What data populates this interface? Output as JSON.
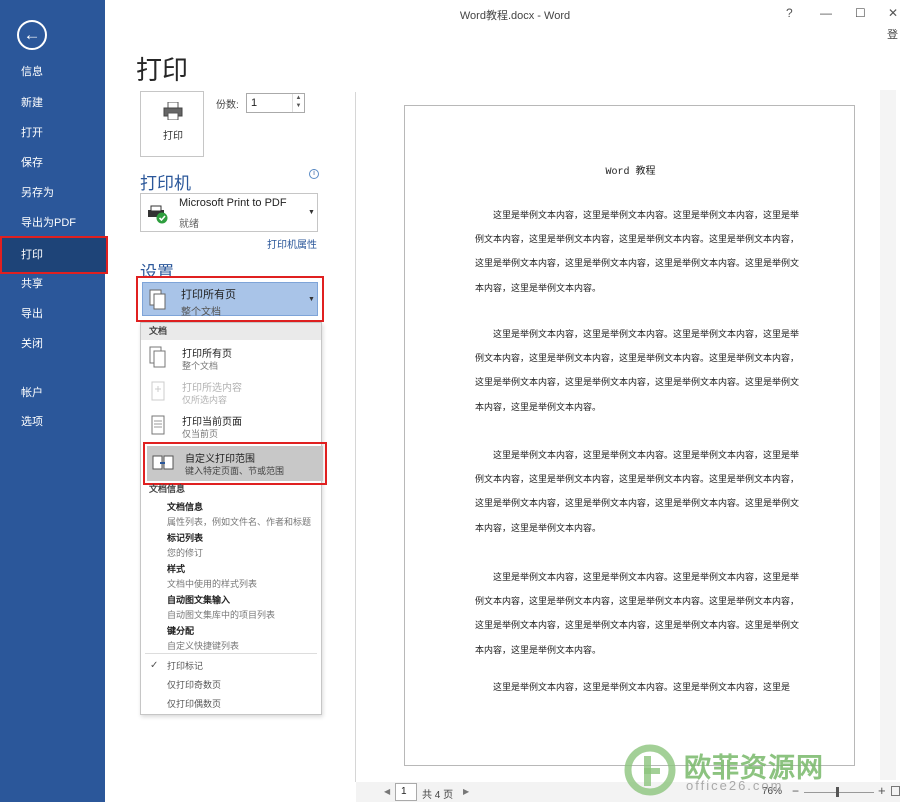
{
  "window": {
    "title": "Word教程.docx - Word",
    "signin": "登",
    "controls": {
      "help": "?",
      "minimize": "—",
      "maximize": "☐",
      "close": "✕"
    }
  },
  "sidebar": {
    "back_icon": "arrow-left-icon",
    "items": [
      {
        "label": "信息"
      },
      {
        "label": "新建"
      },
      {
        "label": "打开"
      },
      {
        "label": "保存"
      },
      {
        "label": "另存为"
      },
      {
        "label": "导出为PDF"
      },
      {
        "label": "打印",
        "selected": true
      },
      {
        "label": "共享"
      },
      {
        "label": "导出"
      },
      {
        "label": "关闭"
      },
      {
        "label": "帐户"
      },
      {
        "label": "选项"
      }
    ]
  },
  "print": {
    "title": "打印",
    "button_label": "打印",
    "copies_label": "份数:",
    "copies_value": "1"
  },
  "printer": {
    "heading": "打印机",
    "name": "Microsoft Print to PDF",
    "status": "就绪",
    "properties_link": "打印机属性"
  },
  "settings": {
    "heading": "设置",
    "selected_main": "打印所有页",
    "selected_sub": "整个文档"
  },
  "menu": {
    "section_doc": "文档",
    "items": [
      {
        "title": "打印所有页",
        "sub": "整个文档",
        "enabled": true
      },
      {
        "title": "打印所选内容",
        "sub": "仅所选内容",
        "enabled": false
      },
      {
        "title": "打印当前页面",
        "sub": "仅当前页",
        "enabled": true
      },
      {
        "title": "自定义打印范围",
        "sub": "键入特定页面、节或范围",
        "enabled": true,
        "highlighted": true
      }
    ],
    "section_info": "文档信息",
    "info_items": [
      {
        "title": "文档信息",
        "sub": "属性列表，例如文件名、作者和标题"
      },
      {
        "title": "标记列表",
        "sub": "您的修订"
      },
      {
        "title": "样式",
        "sub": "文档中使用的样式列表"
      },
      {
        "title": "自动图文集输入",
        "sub": "自动图文集库中的项目列表"
      },
      {
        "title": "键分配",
        "sub": "自定义快捷键列表"
      }
    ],
    "options": [
      "打印标记",
      "仅打印奇数页",
      "仅打印偶数页"
    ],
    "check": "✓"
  },
  "preview": {
    "doc_title": "Word 教程",
    "paragraphs": [
      "这里是举例文本内容，这里是举例文本内容。这里是举例文本内容，这里是举例文本内容，这里是举例文本内容，这里是举例文本内容。这里是举例文本内容，这里是举例文本内容，这里是举例文本内容，这里是举例文本内容。这里是举例文本内容，这里是举例文本内容。",
      "这里是举例文本内容，这里是举例文本内容。这里是举例文本内容，这里是举例文本内容，这里是举例文本内容，这里是举例文本内容。这里是举例文本内容，这里是举例文本内容，这里是举例文本内容，这里是举例文本内容。这里是举例文本内容，这里是举例文本内容。",
      "这里是举例文本内容，这里是举例文本内容。这里是举例文本内容，这里是举例文本内容，这里是举例文本内容，这里是举例文本内容。这里是举例文本内容，这里是举例文本内容，这里是举例文本内容，这里是举例文本内容。这里是举例文本内容，这里是举例文本内容。",
      "这里是举例文本内容，这里是举例文本内容。这里是举例文本内容，这里是举例文本内容，这里是举例文本内容，这里是举例文本内容。这里是举例文本内容，这里是举例文本内容，这里是举例文本内容，这里是举例文本内容。这里是举例文本内容，这里是举例文本内容。",
      "这里是举例文本内容，这里是举例文本内容。这里是举例文本内容，这里是"
    ]
  },
  "status": {
    "page_current": "1",
    "page_total": "共 4 页",
    "zoom": "76%",
    "prev": "◀",
    "next": "▶",
    "minus": "−",
    "plus": "+"
  },
  "watermark": {
    "text": "欧菲资源网",
    "url": "office26.com"
  },
  "colors": {
    "accent": "#2b579a",
    "highlight_border": "#e02020",
    "selected_bg": "#a9c4e8"
  }
}
